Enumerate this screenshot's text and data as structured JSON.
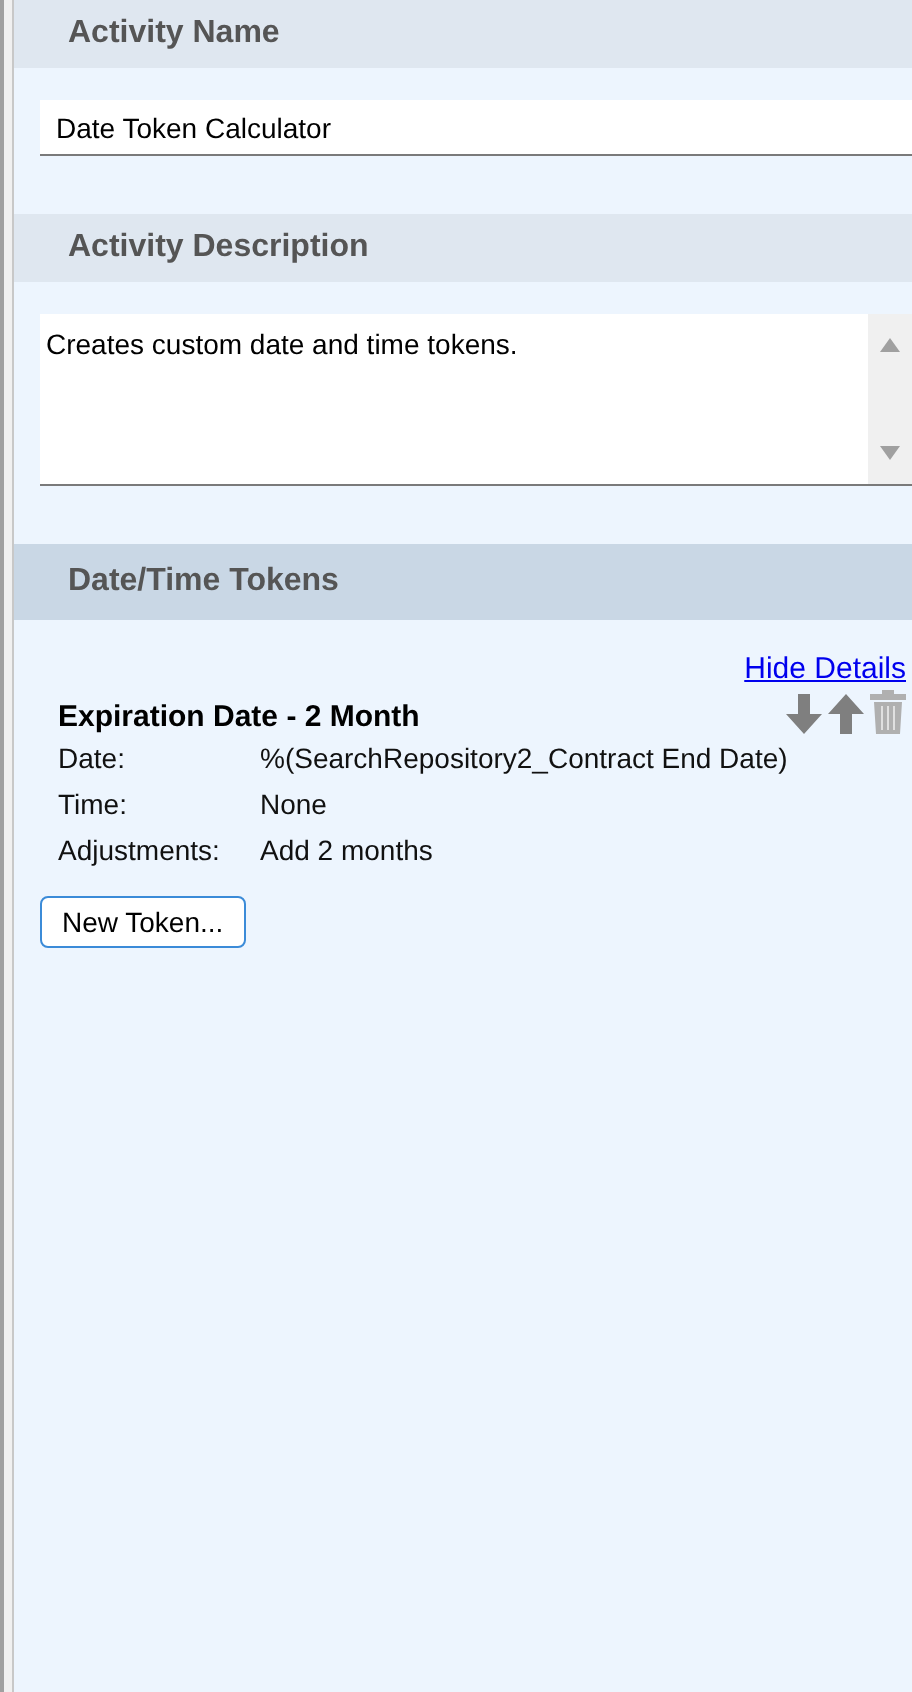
{
  "activity_name": {
    "heading": "Activity Name",
    "value": "Date Token Calculator"
  },
  "activity_description": {
    "heading": "Activity Description",
    "value": "Creates custom date and time tokens."
  },
  "tokens_section": {
    "heading": "Date/Time Tokens",
    "selected": true,
    "toggle_link": "Hide Details",
    "tokens": [
      {
        "title": "Expiration Date - 2 Month",
        "details": [
          {
            "label": "Date:",
            "value": "%(SearchRepository2_Contract End Date)"
          },
          {
            "label": "Time:",
            "value": "None"
          },
          {
            "label": "Adjustments:",
            "value": "Add 2 months"
          }
        ]
      }
    ],
    "new_button": "New Token..."
  }
}
